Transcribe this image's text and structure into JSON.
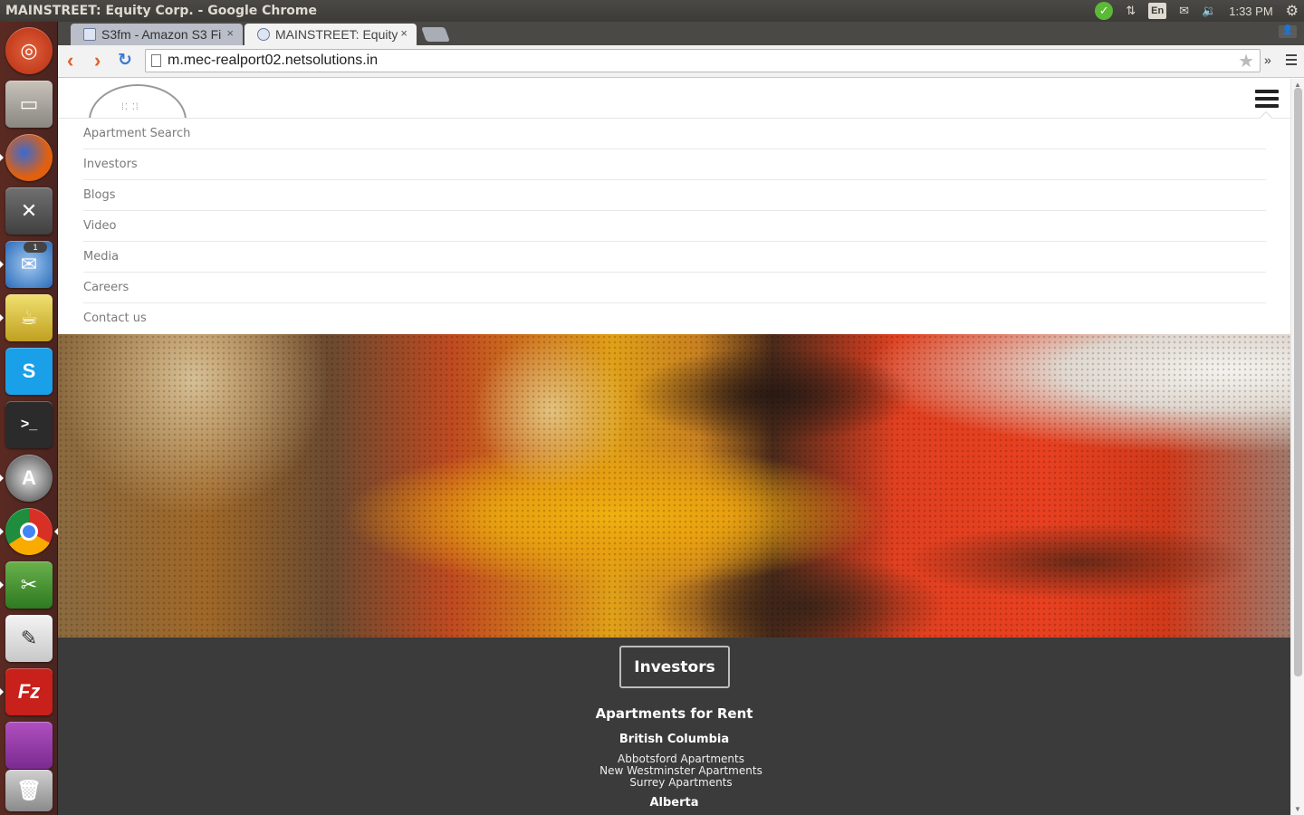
{
  "os": {
    "window_title": "MAINSTREET: Equity Corp. - Google Chrome",
    "tray": {
      "keyboard_layout": "En",
      "time": "1:33 PM"
    },
    "launcher_icons": [
      "ubuntu-dash",
      "files",
      "firefox",
      "system-settings",
      "thunderbird",
      "genie",
      "skype",
      "terminal",
      "software-updater",
      "chrome",
      "tools",
      "text-editor",
      "filezilla",
      "workspace-switcher",
      "trash"
    ],
    "launcher_badges": {
      "thunderbird": "1"
    }
  },
  "browser": {
    "tabs": [
      {
        "label": "S3fm - Amazon S3 Fi",
        "active": false
      },
      {
        "label": "MAINSTREET: Equity",
        "active": true
      }
    ],
    "url": "m.mec-realport02.netsolutions.in"
  },
  "site": {
    "nav_menu": [
      "Apartment Search",
      "Investors",
      "Blogs",
      "Video",
      "Media",
      "Careers",
      "Contact us"
    ],
    "footer": {
      "investors_button": "Investors",
      "section_title": "Apartments for Rent",
      "regions": [
        {
          "name": "British Columbia",
          "links": [
            "Abbotsford Apartments",
            "New Westminster Apartments",
            "Surrey Apartments"
          ]
        },
        {
          "name": "Alberta",
          "links": []
        }
      ]
    }
  },
  "colors": {
    "ubuntu_panel": "#3c3b37",
    "launcher": "#5a2a22",
    "footer_bg": "#3b3b3b",
    "menu_text": "#7a7a7a"
  }
}
